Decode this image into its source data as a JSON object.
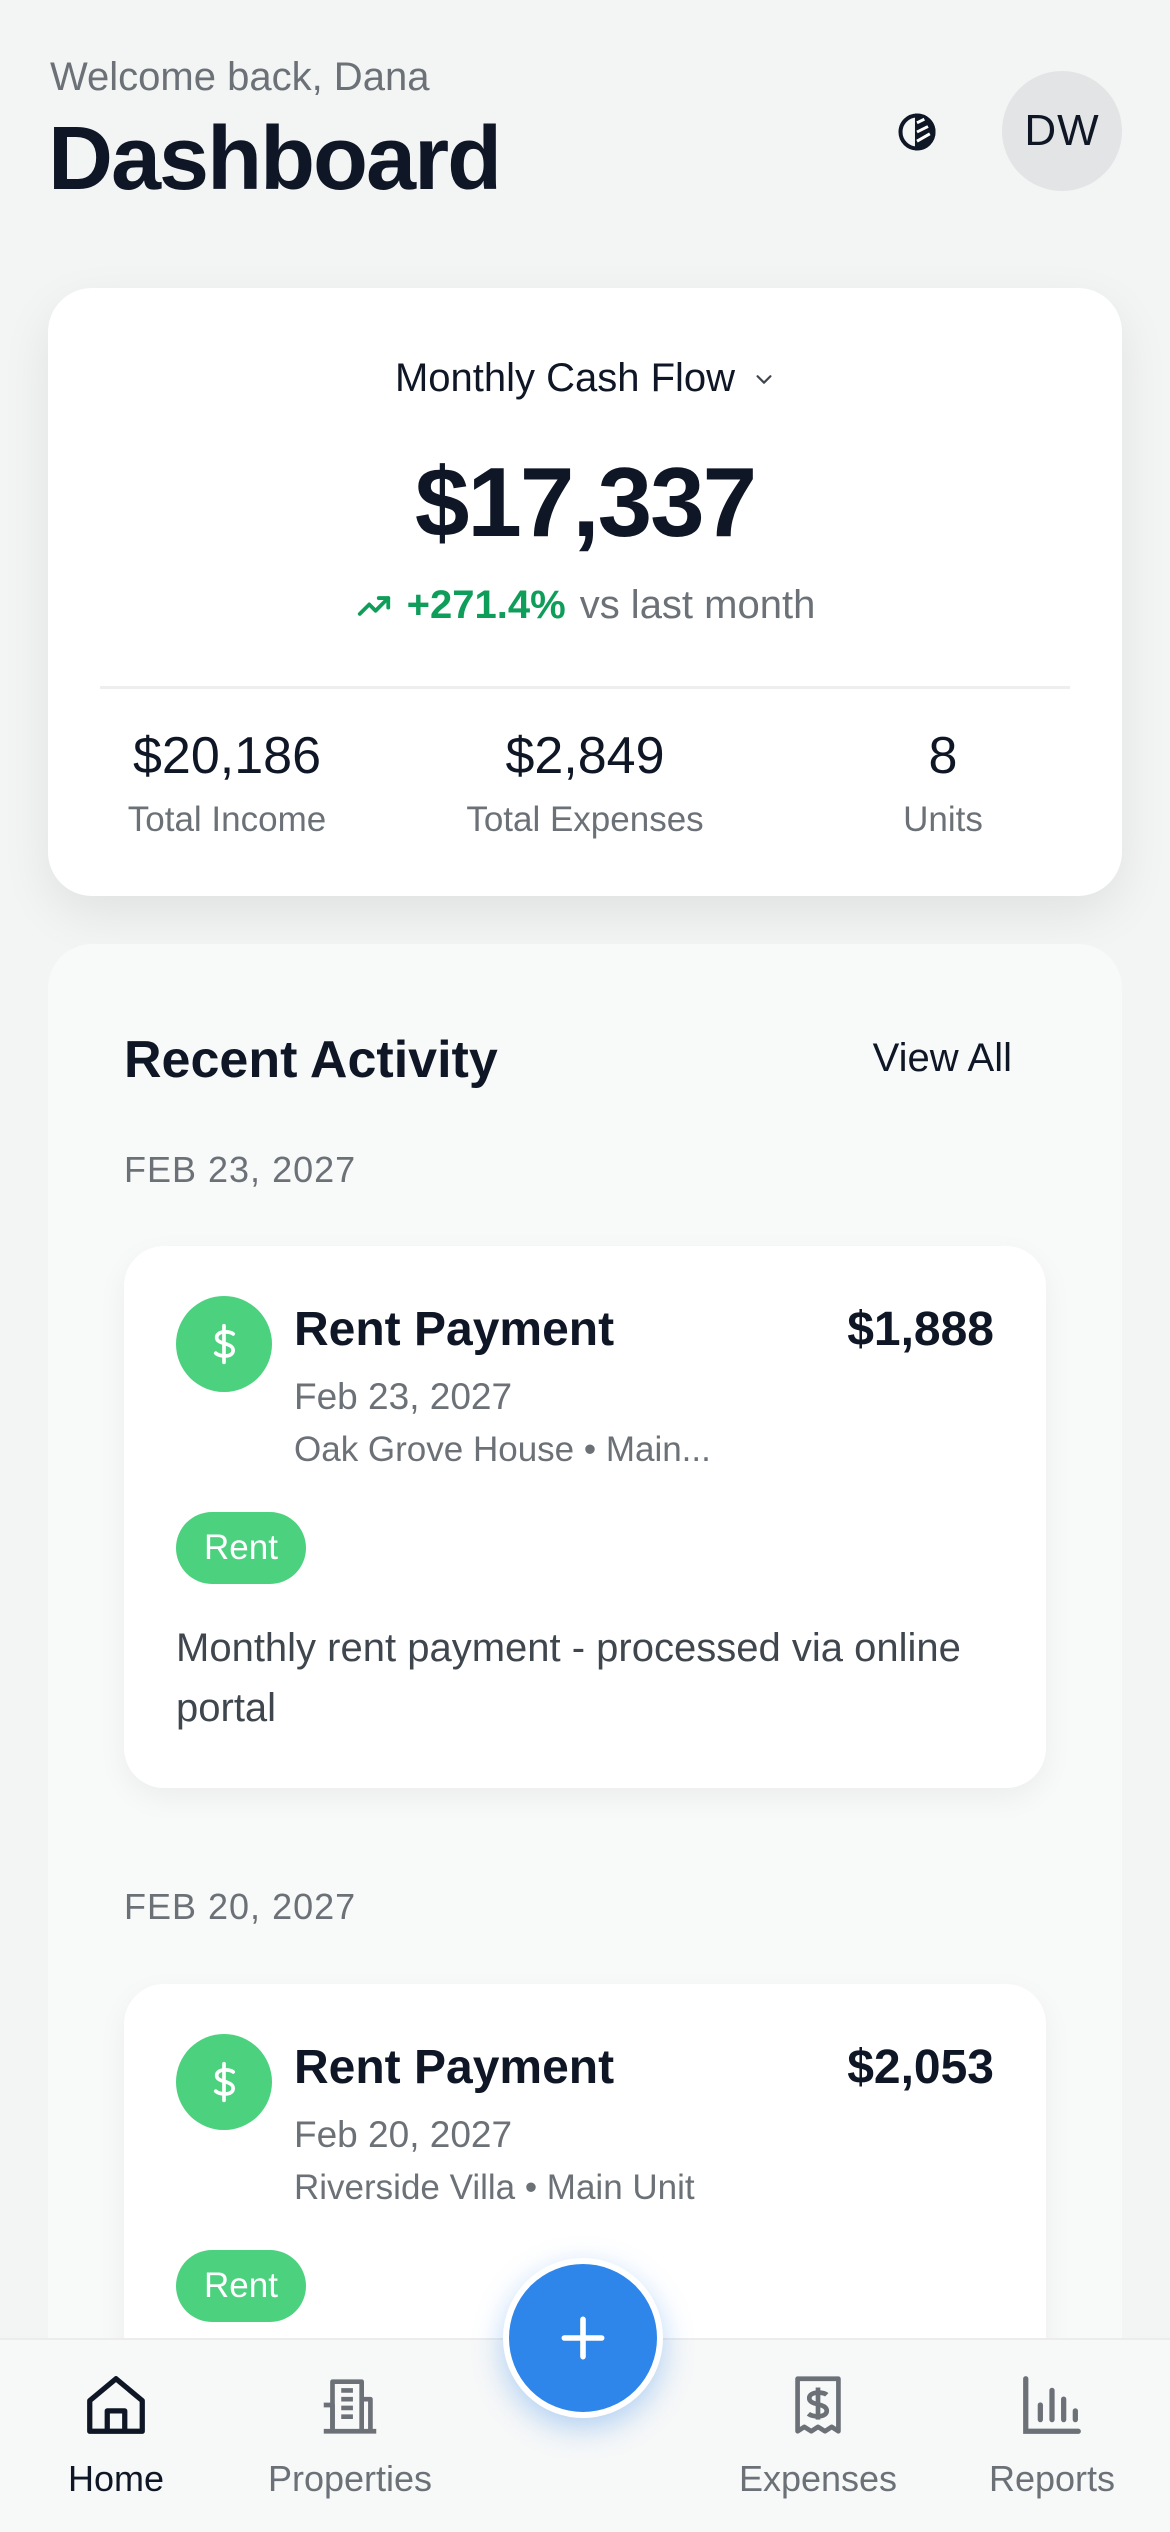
{
  "header": {
    "welcome": "Welcome back, Dana",
    "title": "Dashboard",
    "avatar_initials": "DW",
    "theme_icon": "contrast-icon"
  },
  "summary": {
    "title": "Monthly Cash Flow",
    "amount": "$17,337",
    "change_pct": "+271.4%",
    "change_text": "vs last month",
    "stats": [
      {
        "value": "$20,186",
        "label": "Total Income"
      },
      {
        "value": "$2,849",
        "label": "Total Expenses"
      },
      {
        "value": "8",
        "label": "Units"
      }
    ]
  },
  "activity": {
    "title": "Recent Activity",
    "view_all": "View All",
    "groups": [
      {
        "date_label": "FEB 23, 2027",
        "name": "Rent Payment",
        "amount": "$1,888",
        "date": "Feb 23, 2027",
        "location": "Oak Grove House • Main...",
        "tag": "Rent",
        "description": "Monthly rent payment - processed via online portal"
      },
      {
        "date_label": "FEB 20, 2027",
        "name": "Rent Payment",
        "amount": "$2,053",
        "date": "Feb 20, 2027",
        "location": "Riverside Villa • Main Unit",
        "tag": "Rent",
        "description": ""
      }
    ]
  },
  "nav": {
    "items": [
      {
        "label": "Home",
        "icon": "home-icon",
        "active": true
      },
      {
        "label": "Properties",
        "icon": "building-icon",
        "active": false
      },
      {
        "label": "Expenses",
        "icon": "receipt-icon",
        "active": false
      },
      {
        "label": "Reports",
        "icon": "bar-chart-icon",
        "active": false
      }
    ],
    "fab_icon": "plus-icon"
  },
  "colors": {
    "accent": "#2f86ea",
    "positive": "#0f9d5a",
    "tag_green": "#4cd17f"
  }
}
